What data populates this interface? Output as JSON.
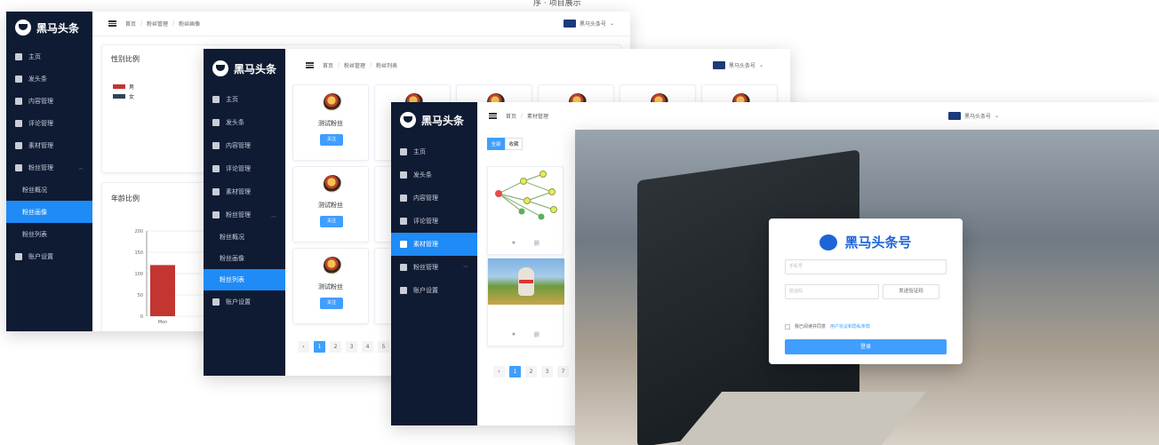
{
  "caption": "序 · 项目展示",
  "brand": {
    "logo_text": "黑马头条"
  },
  "menu": {
    "home": "主页",
    "publish": "发头条",
    "content": "内容管理",
    "comment": "评论管理",
    "material": "素材管理",
    "fans": "粉丝管理",
    "fans_overview": "粉丝概况",
    "fans_portrait": "粉丝画像",
    "fans_list": "粉丝列表",
    "account": "账户设置"
  },
  "breadcrumb": {
    "home": "首页",
    "fans": "粉丝管理",
    "portrait": "粉丝画像",
    "list": "粉丝列表",
    "material": "素材管理"
  },
  "user": {
    "name": "黑马头条号"
  },
  "portrait": {
    "gender_title": "性别比例",
    "gender_legend": [
      "男",
      "女"
    ],
    "age_title": "年龄比例",
    "colors": {
      "male": "#c23531",
      "female": "#2f4554"
    }
  },
  "chart_data": {
    "type": "bar",
    "categories": [
      "Mon"
    ],
    "values": [
      120
    ],
    "ylim": [
      0,
      200
    ],
    "yticks": [
      "200",
      "150",
      "100",
      "50",
      "0"
    ]
  },
  "fans": {
    "items": [
      {
        "name": "测试粉丝",
        "button": "关注"
      },
      {
        "name": "测试粉丝",
        "button": "关注"
      },
      {
        "name": "测试粉丝",
        "button": "关注"
      }
    ],
    "pages": [
      "1",
      "2",
      "3",
      "4",
      "5"
    ]
  },
  "material": {
    "tabs": [
      "全部",
      "收藏"
    ],
    "pages": [
      "1",
      "2",
      "3",
      "7"
    ],
    "action_star": "★",
    "action_delete": "删"
  },
  "login": {
    "title": "黑马头条号",
    "phone_placeholder": "手机号",
    "code_placeholder": "验证码",
    "send_code": "发送验证码",
    "agree_prefix": "我已阅读并同意",
    "agree_link": "用户协议和隐私条款",
    "submit": "登录"
  }
}
